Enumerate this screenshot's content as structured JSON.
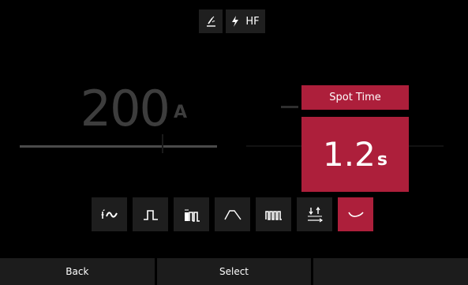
{
  "header": {
    "torch_icon": "torch-icon",
    "hf_icon": "lightning-icon",
    "hf_label": "HF"
  },
  "current": {
    "value": "200",
    "unit": "A"
  },
  "parameter": {
    "label": "Spot Time",
    "value": "1.2",
    "unit": "s"
  },
  "modes": [
    {
      "icon": "hotstart-wave-icon",
      "active": false
    },
    {
      "icon": "pulse-single-icon",
      "active": false
    },
    {
      "icon": "pulse-multi-bar-icon",
      "active": false
    },
    {
      "icon": "ramp-icon",
      "active": false
    },
    {
      "icon": "pulse-train-icon",
      "active": false
    },
    {
      "icon": "trigger-up-down-icon",
      "active": false
    },
    {
      "icon": "spot-wave-icon",
      "active": true
    }
  ],
  "footer": {
    "back_label": "Back",
    "select_label": "Select",
    "third_label": ""
  },
  "colors": {
    "accent": "#ad1f3b",
    "panel": "#1e1e1e",
    "background": "#000000"
  }
}
